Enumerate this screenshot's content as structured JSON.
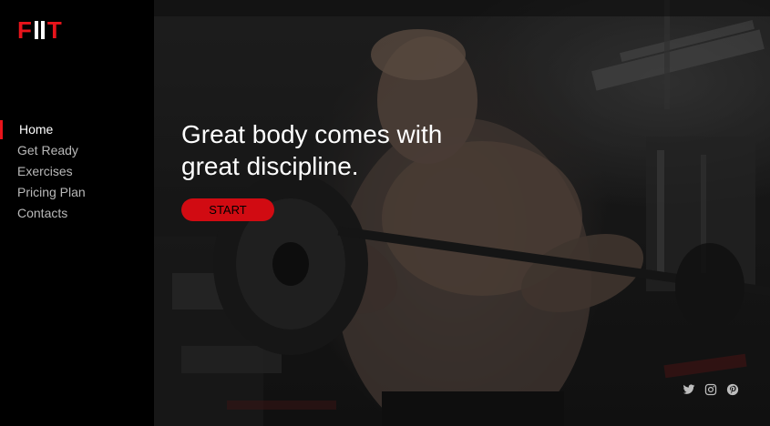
{
  "brand": {
    "logo_first": "F",
    "logo_last": "T",
    "accent_color": "#e8141b"
  },
  "sidebar": {
    "items": [
      {
        "label": "Home",
        "active": true
      },
      {
        "label": "Get Ready",
        "active": false
      },
      {
        "label": "Exercises",
        "active": false
      },
      {
        "label": "Pricing Plan",
        "active": false
      },
      {
        "label": "Contacts",
        "active": false
      }
    ]
  },
  "hero": {
    "headline_line1": "Great body comes with",
    "headline_line2": "great discipline.",
    "cta_label": "START",
    "background": "dark gym photo of man lifting barbell"
  },
  "social": {
    "icons": [
      "twitter-icon",
      "instagram-icon",
      "pinterest-icon"
    ]
  }
}
